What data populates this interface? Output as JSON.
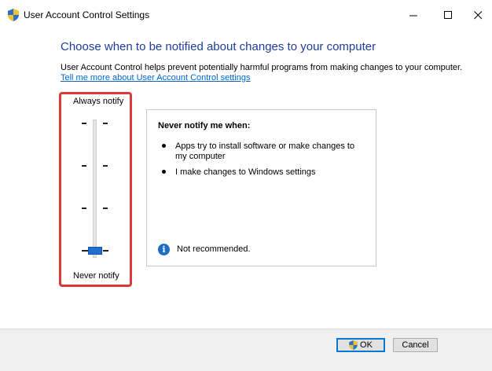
{
  "window": {
    "title": "User Account Control Settings",
    "icon": "uac-shield-icon"
  },
  "header": {
    "heading": "Choose when to be notified about changes to your computer",
    "description": "User Account Control helps prevent potentially harmful programs from making changes to your computer.",
    "link": "Tell me more about User Account Control settings"
  },
  "slider": {
    "top_label": "Always notify",
    "bottom_label": "Never notify",
    "levels": 4,
    "selected_level": 1
  },
  "info": {
    "heading": "Never notify me when:",
    "bullets": [
      "Apps try to install software or make changes to my computer",
      "I make changes to Windows settings"
    ],
    "note": "Not recommended."
  },
  "buttons": {
    "ok": "OK",
    "cancel": "Cancel"
  },
  "colors": {
    "heading": "#1f3d99",
    "link": "#0066cc",
    "highlight_box": "#d93a3a",
    "slider_thumb": "#1e6fd1"
  }
}
